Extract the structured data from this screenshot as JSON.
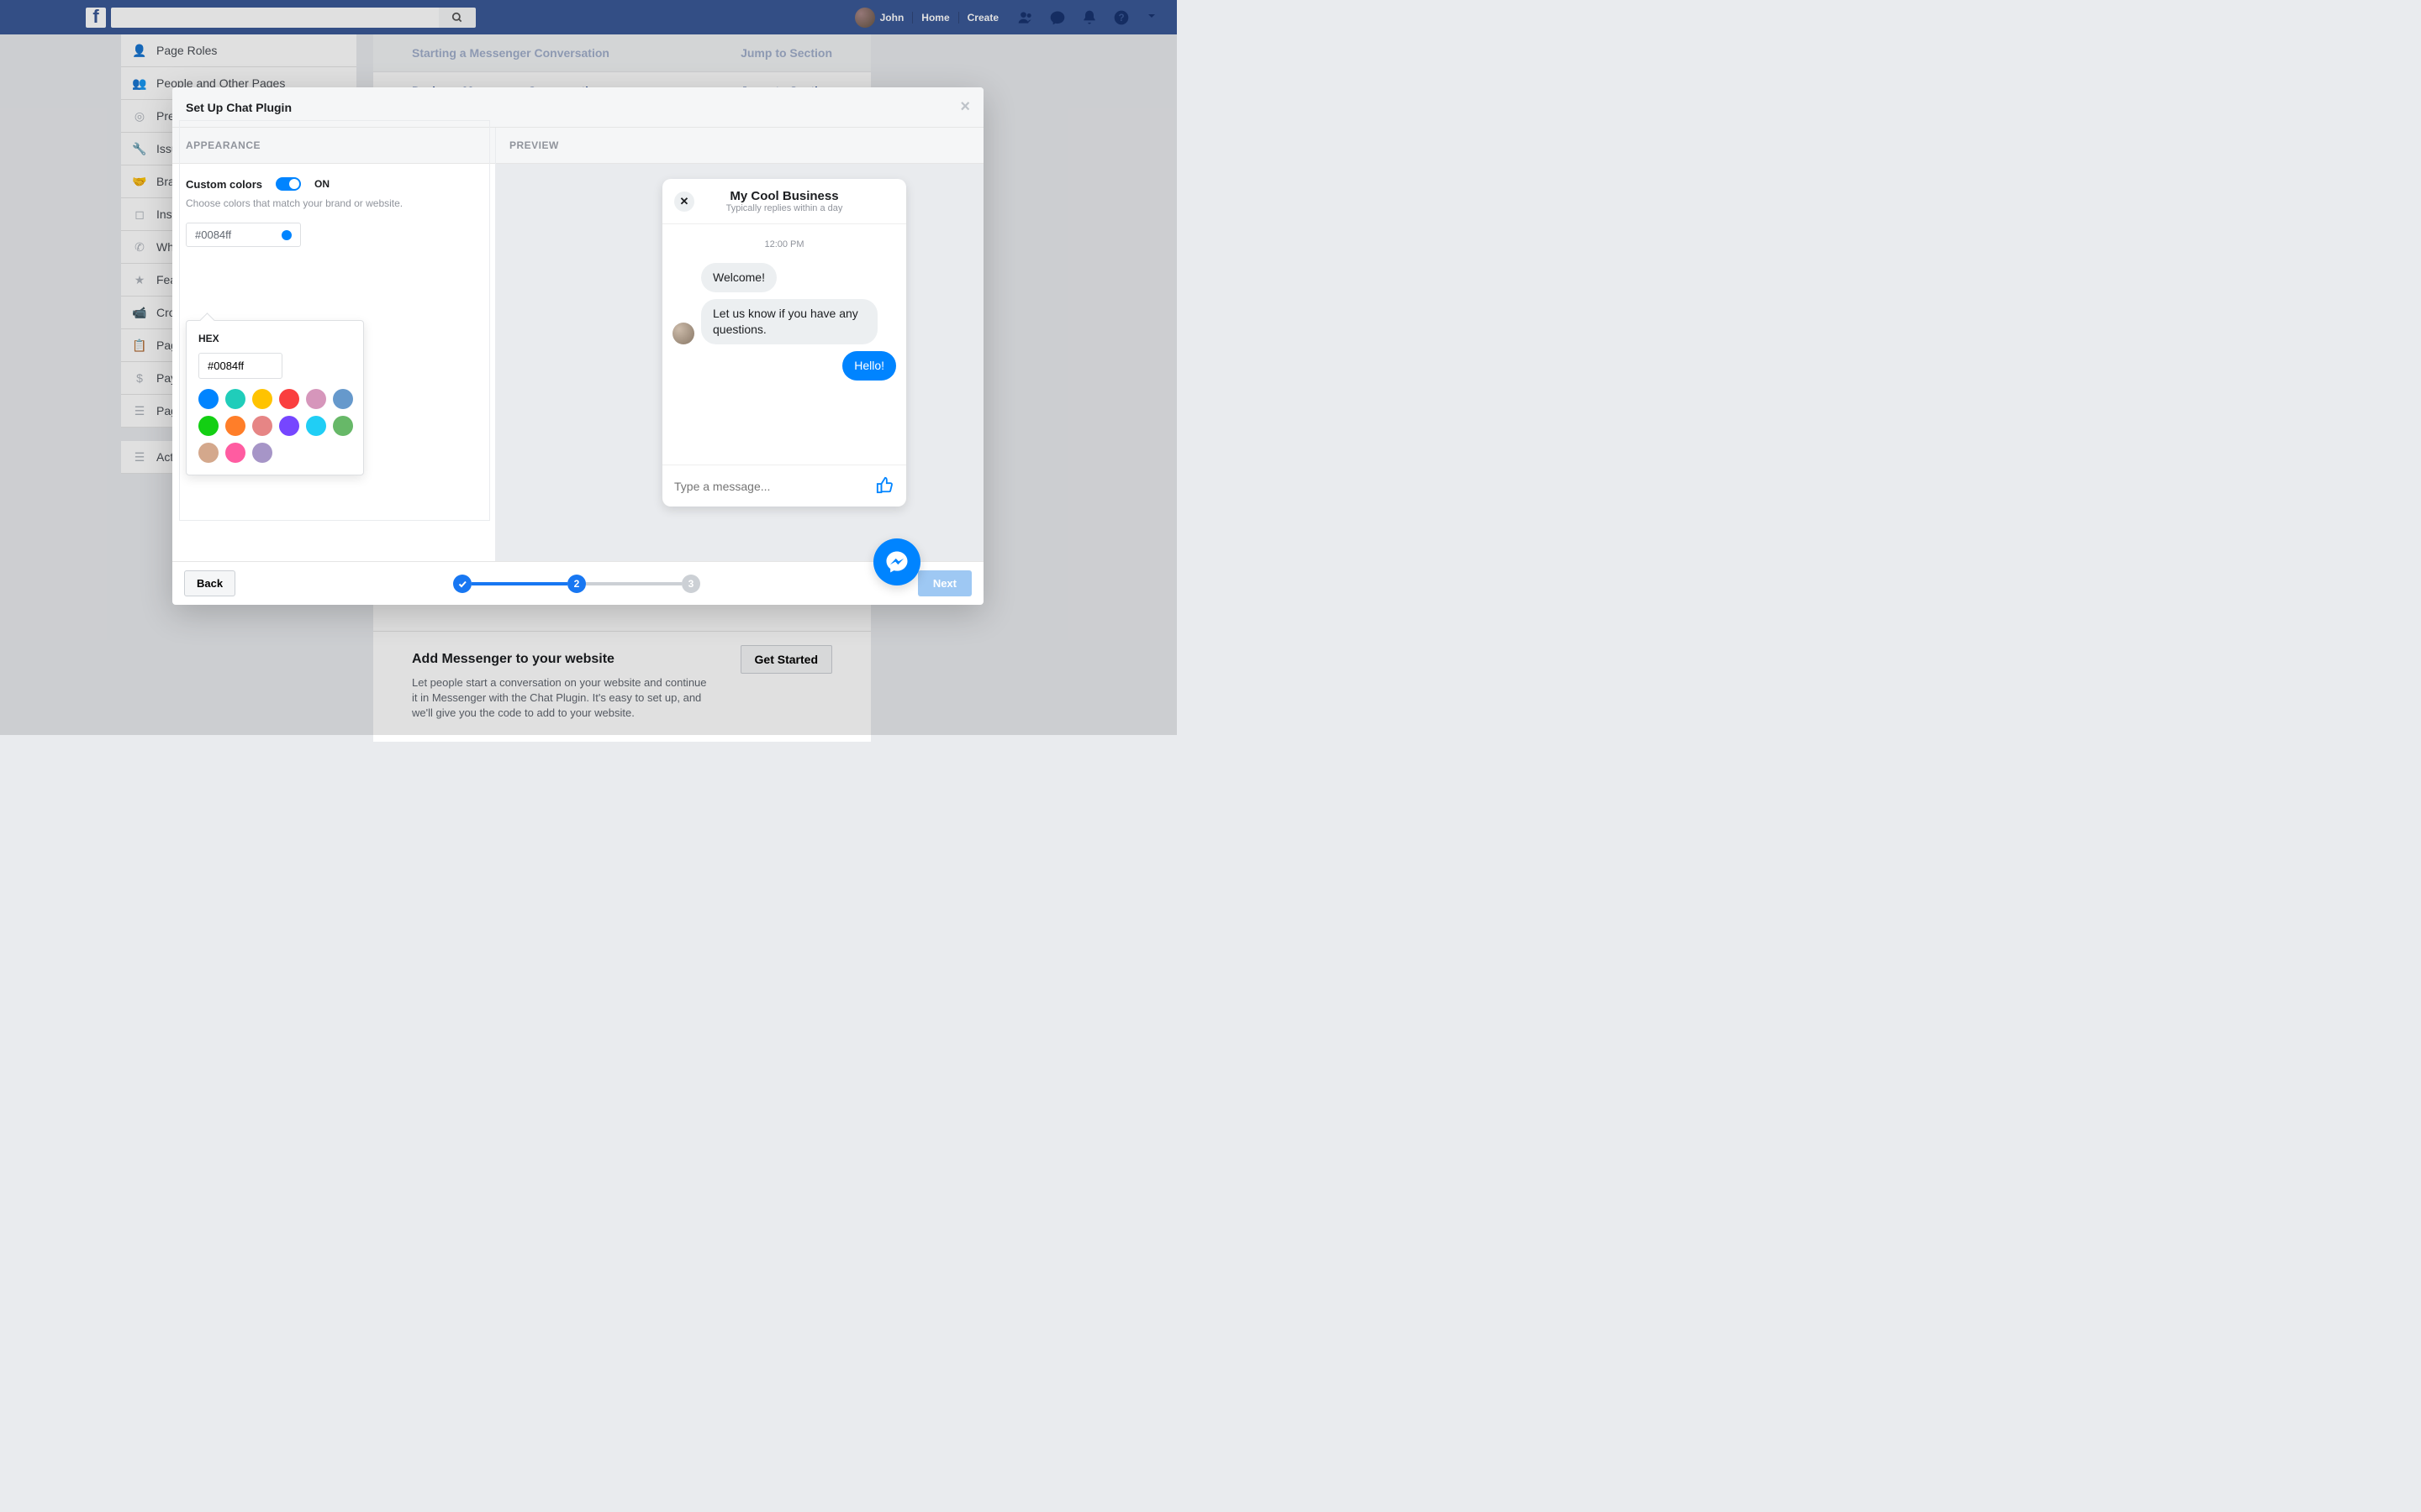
{
  "topnav": {
    "userName": "John",
    "links": {
      "home": "Home",
      "create": "Create"
    }
  },
  "sidebar": {
    "items": [
      "Page Roles",
      "People and Other Pages",
      "Preferred Page Audience",
      "Issue, Electoral or Political Ads",
      "Branded Content",
      "Instagram",
      "WhatsApp",
      "Featured",
      "Crossposting",
      "Page Support Inbox",
      "Payments",
      "Page Management History"
    ],
    "activityLabel": "Activity Log"
  },
  "pageMain": {
    "rows": [
      {
        "title": "Starting a Messenger Conversation",
        "action": "Jump to Section"
      },
      {
        "title": "During a Messenger Conversation",
        "action": "Jump to Section"
      }
    ],
    "promoTitle": "Add Messenger to your website",
    "promoBody": "Let people start a conversation on your website and continue it in Messenger with the Chat Plugin. It's easy to set up, and we'll give you the code to add to your website.",
    "getStarted": "Get Started"
  },
  "modal": {
    "title": "Set Up Chat Plugin",
    "appearanceLabel": "APPEARANCE",
    "previewLabel": "PREVIEW",
    "customColorsLabel": "Custom colors",
    "toggleStateLabel": "ON",
    "helper": "Choose colors that match your brand or website.",
    "colorValue": "#0084ff",
    "hexLabel": "HEX",
    "hexInputValue": "#0084ff",
    "swatches": [
      "#0084ff",
      "#20cdba",
      "#ffc300",
      "#fa3e3e",
      "#d696bb",
      "#6699cc",
      "#13cf13",
      "#ff7e29",
      "#e68585",
      "#7646ff",
      "#20cef5",
      "#67b868",
      "#d4a88c",
      "#ff5ca1",
      "#a695c7"
    ],
    "backLabel": "Back",
    "nextLabel": "Next",
    "steps": {
      "s2": "2",
      "s3": "3"
    }
  },
  "preview": {
    "businessName": "My Cool Business",
    "subtitle": "Typically replies within a day",
    "time": "12:00 PM",
    "welcome": "Welcome!",
    "help": "Let us know if you have any questions.",
    "reply": "Hello!",
    "placeholder": "Type a message..."
  }
}
